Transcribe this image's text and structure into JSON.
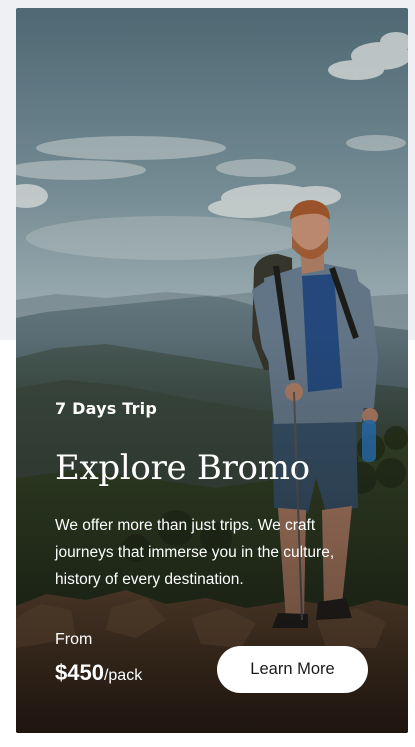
{
  "card": {
    "duration_label": "7 Days Trip",
    "title": "Explore Bromo",
    "description": "We offer more than just trips. We craft journeys that immerse you in the culture, history of every destination.",
    "price_prefix": "From",
    "price_amount": "$450",
    "price_unit": "/pack",
    "cta_label": "Learn More"
  },
  "colors": {
    "page_background": "#eef0f4",
    "text": "#ffffff",
    "button_background": "#ffffff",
    "button_text": "#1b1b1b"
  }
}
